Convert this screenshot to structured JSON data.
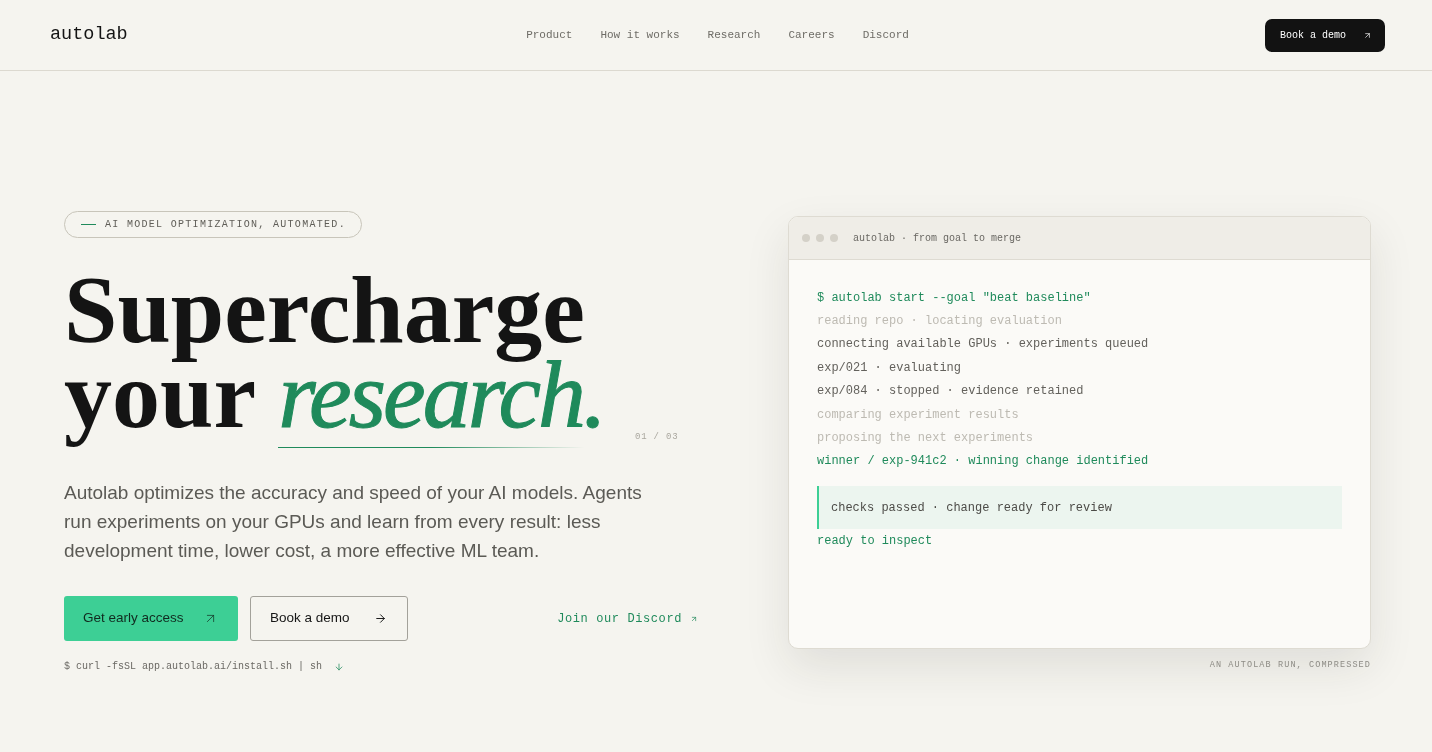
{
  "nav": {
    "logo": "autolab",
    "links": [
      "Product",
      "How it works",
      "Research",
      "Careers",
      "Discord"
    ],
    "cta": "Book a demo"
  },
  "hero": {
    "tagline": "AI MODEL OPTIMIZATION, AUTOMATED.",
    "headline": "Supercharge your *research.*",
    "slide_counter": "01 / 03",
    "description": "Autolab optimizes the accuracy and speed of your AI models. Agents run experiments on your GPUs and learn from every result: less development time, lower cost, a more effective ML team.",
    "buttons": [
      {
        "label": "Get early access",
        "kind": "primary"
      },
      {
        "label": "Book a demo",
        "kind": "secondary"
      }
    ],
    "discord_link": "Join our Discord",
    "install_command": "$ curl -fsSL app.autolab.ai/install.sh | sh"
  },
  "terminal": {
    "title": "autolab · from goal to merge",
    "lines": [
      {
        "text": "$ autolab start --goal \"beat baseline\"",
        "kind": "command"
      },
      {
        "text": "reading repo · locating evaluation",
        "kind": "muted"
      },
      {
        "text": "connecting available GPUs · experiments queued",
        "kind": "normal"
      },
      {
        "text": "exp/021 · evaluating",
        "kind": "normal"
      },
      {
        "text": "exp/084 · stopped · evidence retained",
        "kind": "normal"
      },
      {
        "text": "comparing experiment results",
        "kind": "muted"
      },
      {
        "text": "proposing the next experiments",
        "kind": "muted"
      },
      {
        "text": "winner / exp-941c2 · winning change identified",
        "kind": "success"
      },
      {
        "text": "checks passed · change ready for review",
        "kind": "callout"
      },
      {
        "text": "ready to inspect",
        "kind": "success"
      }
    ],
    "caption": "AN AUTOLAB RUN, COMPRESSED"
  }
}
